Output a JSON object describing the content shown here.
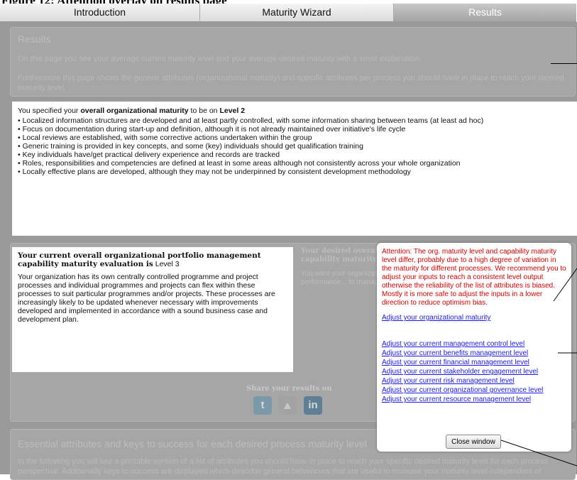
{
  "caption": "Figure 12: Attention overlay on results page",
  "tabs": [
    "Introduction",
    "Maturity Wizard",
    "Results"
  ],
  "results_panel": {
    "title": "Results",
    "line1": "On this page you see your average current maturity level and your average desired maturity with a small explanation.",
    "line2": "Furthermore this page shows the generic attributes (organizational maturity) and specific attributes per process you should have in place to reach your desired maturity level."
  },
  "org_maturity": {
    "intro_prefix": "You specified your ",
    "intro_bold": "overall organizational maturity",
    "intro_mid": " to be on ",
    "level_label": "Level 2",
    "bullets": [
      "Localized information structures are developed and at least partly controlled, with some information sharing between teams (at least ad hoc)",
      "Focus on documentation during start-up and definition, although it is not already maintained over initiative's life cycle",
      "Local reviews are established, with some corrective actions undertaken within the group",
      "Generic training is provided in key concepts, and some (key) individuals should get qualification training",
      "Key individuals have/get practical delivery experience and records are tracked",
      "Roles, responsibilities and competencies are defined at least in some areas although not consistently across your whole organization",
      "Locally effective plans are developed, although they may not be underpinned by consistent development methodology"
    ]
  },
  "capability": {
    "heading_bold": "Your current overall organizational portfolio management capability maturity evaluation is",
    "level": "Level 3",
    "text": "Your organization has its own centrally controlled programme and project processes and individual programmes and projects can flex within these processes to suit particular programmes and/or projects. These processes are increasingly likely to be updated whenever necessary with improvements developed and implemented in accordance with a sound business case and development plan."
  },
  "desired": {
    "heading": "Your desired overall organizational portfolio management capability maturity evaluation is",
    "text": "You want your organization to... metrics on its whole... predicting future performance... to manage programmes..."
  },
  "share": {
    "label": "Share your results on",
    "icons": [
      "twitter-icon",
      "delicious-icon",
      "linkedin-icon"
    ]
  },
  "essential": {
    "title": "Essential attributes and keys to success for each desired process maturity level",
    "text": "In the following you will see a printable version of a list of attributes you should have in place to reach your specific desired maturity level for each process perspective. Additionally keys to success are displayed which describe general behaviours that are useful to increase your maturity level independent of"
  },
  "popup": {
    "warning": "Attention: The org. maturity level and capability maturity level differ, probably due to a high degree of variation in the maturity for different processes. We recommend you to adjust your inputs to reach a consistent level output otherwise the reliability of the list of attributes is biased. Mostly it is more safe to adjust the inputs in a lower direction to reduce optimism bias.",
    "org_link": "Adjust your organizational maturity",
    "links": [
      "Adjust your current management control level",
      "Adjust your current benefits management level",
      "Adjust your current financial management level",
      "Adjust your current stakeholder engagement level",
      "Adjust your current risk management level",
      "Adjust your current organizational governance level",
      "Adjust your current resource management level"
    ],
    "close_label": "Close window"
  },
  "colors": {
    "warning_text": "#e00000",
    "link": "#1a1aee",
    "overlay": "#9a9a9a",
    "active_tab": "#a4a4a4"
  }
}
